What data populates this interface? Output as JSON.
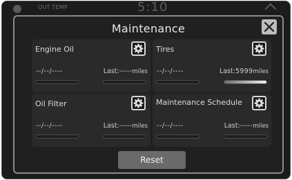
{
  "status_bar": {
    "out_temp_label": "OUT TEMP",
    "clock": "5:10"
  },
  "dialog": {
    "title": "Maintenance",
    "close_icon": "close-icon",
    "reset_label": "Reset"
  },
  "panels": [
    {
      "title": "Engine Oil",
      "date": "--/--/----",
      "last_label": "Last:",
      "last_value": "-----",
      "unit": "miles",
      "progress": 0
    },
    {
      "title": "Tires",
      "date": "--/--/----",
      "last_label": "Last:",
      "last_value": "5999",
      "unit": "miles",
      "progress": 1.0
    },
    {
      "title": "Oil Filter",
      "date": "--/--/----",
      "last_label": "Last:",
      "last_value": "-----",
      "unit": "miles",
      "progress": 0
    },
    {
      "title": "Maintenance Schedule",
      "date": "--/--/----",
      "last_label": "Last:",
      "last_value": "-----",
      "unit": "miles",
      "progress": 0
    }
  ],
  "colors": {
    "background": "#1c1c1c",
    "panel": "#2a2a2a",
    "dialog_border": "#8a8a8a",
    "reset_button": "#6a6a6a",
    "text": "#e8e8e8"
  }
}
